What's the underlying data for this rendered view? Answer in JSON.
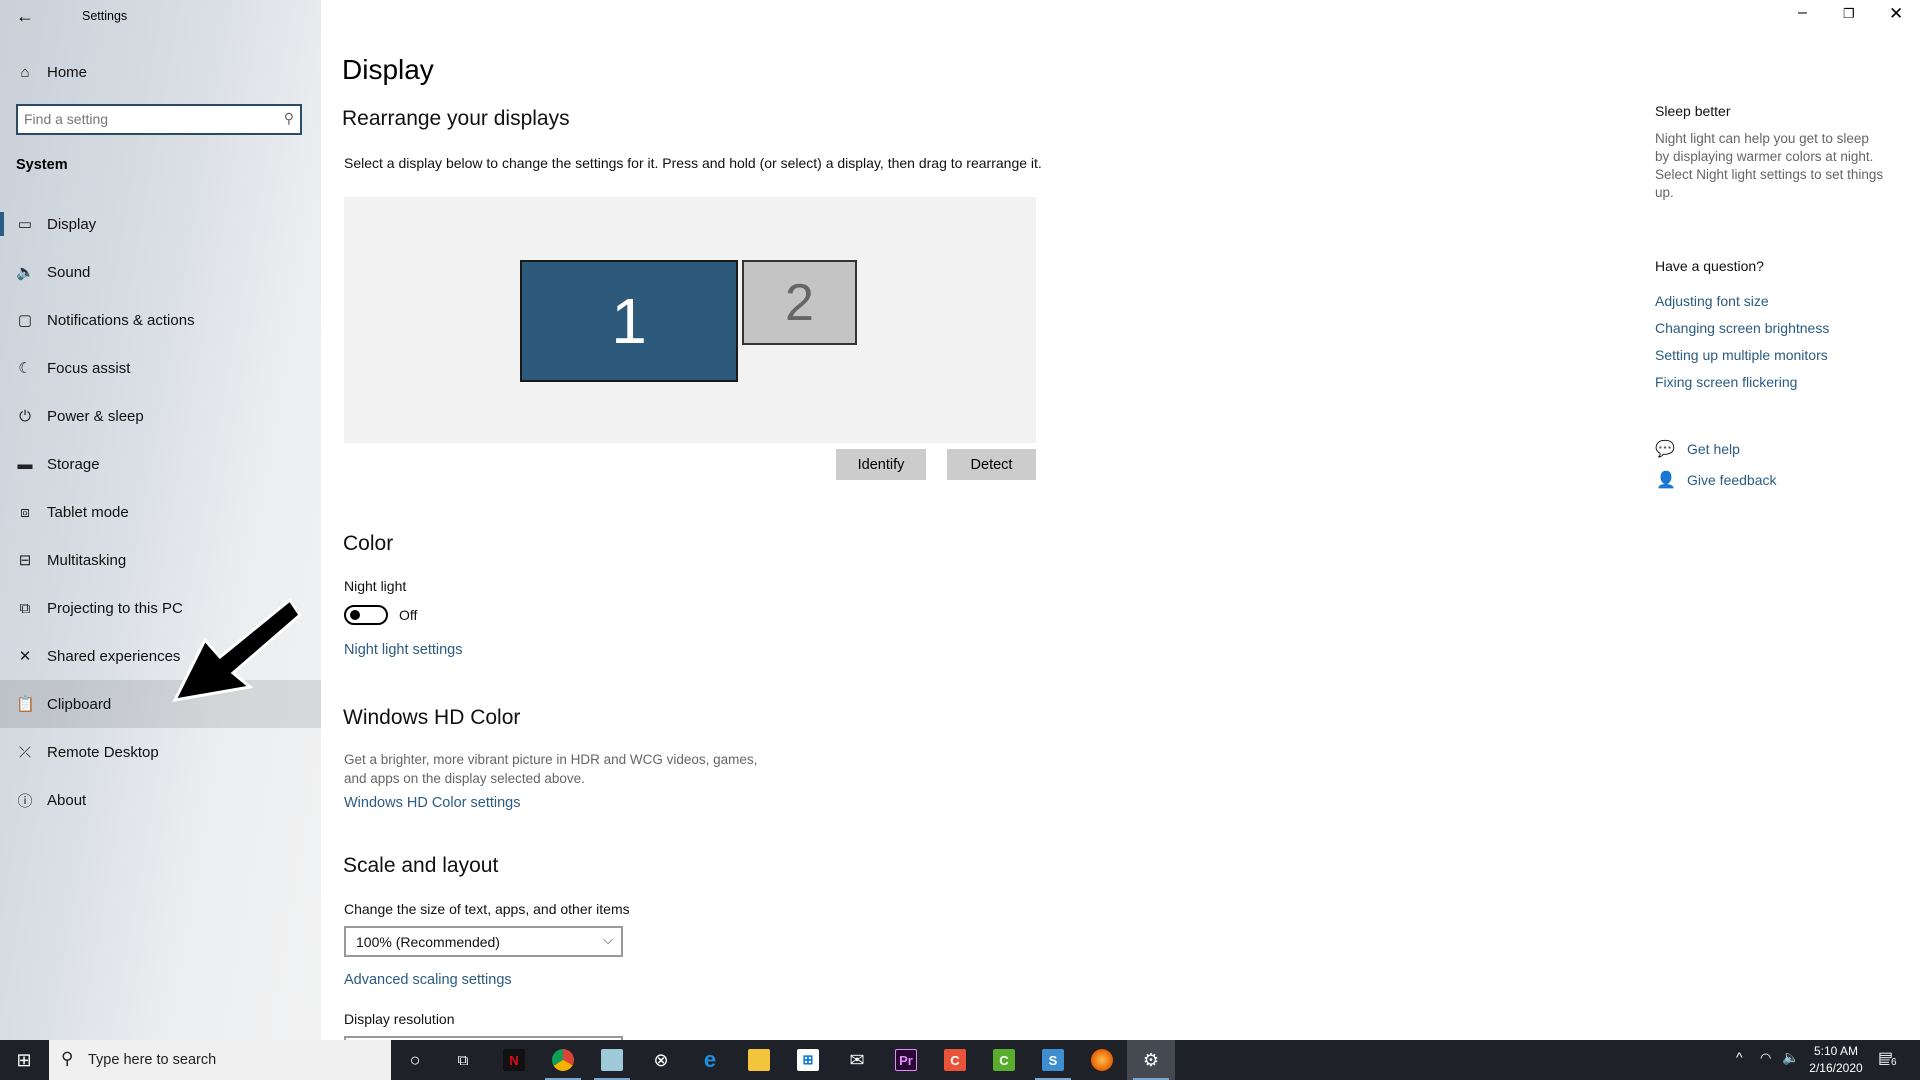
{
  "window": {
    "title": "Settings",
    "controls": [
      "minimize",
      "restore",
      "close"
    ]
  },
  "sidebar": {
    "home": "Home",
    "search_placeholder": "Find a setting",
    "section": "System",
    "items": [
      {
        "label": "Display",
        "icon": "monitor-icon",
        "selected": true
      },
      {
        "label": "Sound",
        "icon": "speaker-icon"
      },
      {
        "label": "Notifications & actions",
        "icon": "notification-icon"
      },
      {
        "label": "Focus assist",
        "icon": "moon-icon"
      },
      {
        "label": "Power & sleep",
        "icon": "power-icon"
      },
      {
        "label": "Storage",
        "icon": "storage-icon"
      },
      {
        "label": "Tablet mode",
        "icon": "tablet-icon"
      },
      {
        "label": "Multitasking",
        "icon": "multitasking-icon"
      },
      {
        "label": "Projecting to this PC",
        "icon": "projecting-icon"
      },
      {
        "label": "Shared experiences",
        "icon": "shared-icon"
      },
      {
        "label": "Clipboard",
        "icon": "clipboard-icon",
        "hovered": true
      },
      {
        "label": "Remote Desktop",
        "icon": "remote-icon"
      },
      {
        "label": "About",
        "icon": "info-icon"
      }
    ]
  },
  "main": {
    "title": "Display",
    "rearrange": {
      "heading": "Rearrange your displays",
      "description": "Select a display below to change the settings for it. Press and hold (or select) a display, then drag to rearrange it.",
      "monitors": [
        "1",
        "2"
      ],
      "identify": "Identify",
      "detect": "Detect"
    },
    "color": {
      "heading": "Color",
      "night_light_label": "Night light",
      "toggle_state": "Off",
      "night_light_link": "Night light settings"
    },
    "hdr": {
      "heading": "Windows HD Color",
      "desc1": "Get a brighter, more vibrant picture in HDR and WCG videos, games,",
      "desc2": "and apps on the display selected above.",
      "link": "Windows HD Color settings"
    },
    "scale": {
      "heading": "Scale and layout",
      "size_label": "Change the size of text, apps, and other items",
      "size_value": "100% (Recommended)",
      "advanced_link": "Advanced scaling settings",
      "resolution_label": "Display resolution"
    }
  },
  "aside": {
    "sleep_title": "Sleep better",
    "sleep_lines": [
      "Night light can help you get to sleep",
      "by displaying warmer colors at night.",
      "Select Night light settings to set things",
      "up."
    ],
    "question_title": "Have a question?",
    "links": [
      "Adjusting font size",
      "Changing screen brightness",
      "Setting up multiple monitors",
      "Fixing screen flickering"
    ],
    "get_help": "Get help",
    "feedback": "Give feedback"
  },
  "taskbar": {
    "search_placeholder": "Type here to search",
    "time": "5:10 AM",
    "date": "2/16/2020",
    "notification_count": "6"
  },
  "colors": {
    "accent": "#2a5b82",
    "monitor1": "#2d5a7b",
    "monitor2": "#c4c4c4",
    "taskbar": "#1e2228"
  }
}
